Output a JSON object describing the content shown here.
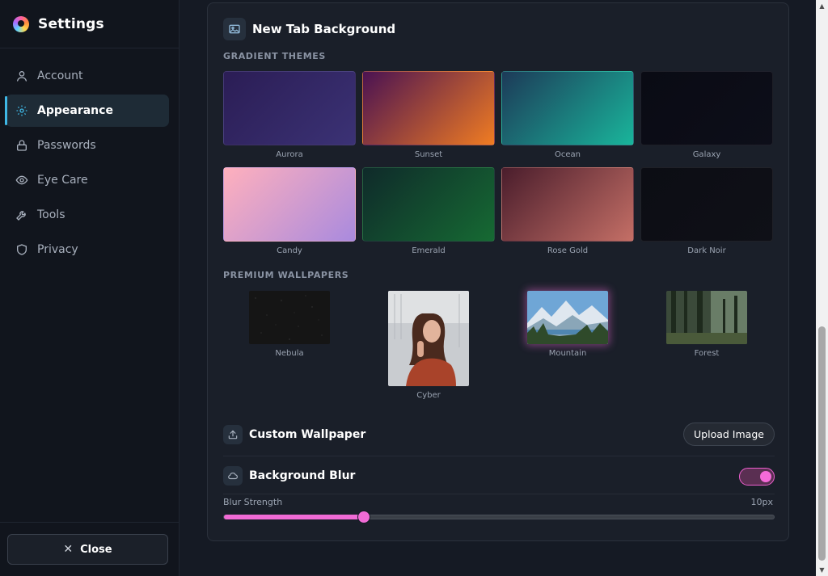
{
  "sidebar": {
    "title": "Settings",
    "items": [
      {
        "label": "Account",
        "icon": "user-icon",
        "active": false
      },
      {
        "label": "Appearance",
        "icon": "sun-icon",
        "active": true
      },
      {
        "label": "Passwords",
        "icon": "lock-icon",
        "active": false
      },
      {
        "label": "Eye Care",
        "icon": "eye-icon",
        "active": false
      },
      {
        "label": "Tools",
        "icon": "wrench-icon",
        "active": false
      },
      {
        "label": "Privacy",
        "icon": "shield-icon",
        "active": false
      }
    ],
    "close_label": "Close"
  },
  "card": {
    "title": "New Tab Background",
    "gradient_label": "GRADIENT THEMES",
    "themes": [
      {
        "name": "Aurora",
        "from": "#2b1d55",
        "to": "#3b3275"
      },
      {
        "name": "Sunset",
        "from": "#4a1252",
        "to": "#f07c22"
      },
      {
        "name": "Ocean",
        "from": "#1d3a58",
        "to": "#19b59b"
      },
      {
        "name": "Galaxy",
        "from": "#0a0b14",
        "to": "#0d0e19"
      },
      {
        "name": "Candy",
        "from": "#ffb0bd",
        "to": "#a98ade"
      },
      {
        "name": "Emerald",
        "from": "#0f2a2a",
        "to": "#166a33"
      },
      {
        "name": "Rose Gold",
        "from": "#4a1d2c",
        "to": "#c46f66"
      },
      {
        "name": "Dark Noir",
        "from": "#0c0d14",
        "to": "#0f1017"
      }
    ],
    "premium_label": "PREMIUM WALLPAPERS",
    "wallpapers": [
      {
        "name": "Nebula"
      },
      {
        "name": "Cyber"
      },
      {
        "name": "Mountain"
      },
      {
        "name": "Forest"
      }
    ],
    "custom_wallpaper_label": "Custom Wallpaper",
    "upload_label": "Upload Image",
    "blur_label": "Background Blur",
    "blur_enabled": true,
    "blur_strength_label": "Blur Strength",
    "blur_value": "10px",
    "blur_fraction": 0.254
  },
  "colors": {
    "accent": "#f06bd5",
    "active_indicator": "#3fb8e6"
  }
}
